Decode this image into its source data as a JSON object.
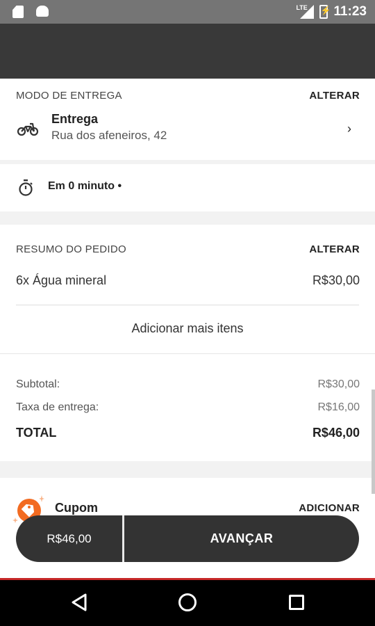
{
  "status_bar": {
    "network": "LTE",
    "time": "11:23"
  },
  "delivery": {
    "section_label": "MODO DE ENTREGA",
    "change_label": "ALTERAR",
    "mode": "Entrega",
    "address": "Rua dos afeneiros, 42",
    "icon": "motorcycle-icon"
  },
  "eta": {
    "text": "Em 0 minuto •",
    "icon": "timer-icon"
  },
  "summary": {
    "section_label": "RESUMO DO PEDIDO",
    "change_label": "ALTERAR",
    "items": [
      {
        "name": "6x Água mineral",
        "price": "R$30,00"
      }
    ],
    "add_more_label": "Adicionar mais itens",
    "subtotal_label": "Subtotal:",
    "subtotal_value": "R$30,00",
    "fee_label": "Taxa de entrega:",
    "fee_value": "R$16,00",
    "total_label": "TOTAL",
    "total_value": "R$46,00"
  },
  "coupon": {
    "label": "Cupom",
    "add_label": "ADICIONAR",
    "icon": "coupon-tag-icon"
  },
  "bottom_bar": {
    "price": "R$46,00",
    "next_label": "AVANÇAR"
  },
  "colors": {
    "accent_orange": "#f26b21",
    "dark": "#333333",
    "app_bar": "#393939",
    "nav_accent": "#c62828"
  }
}
